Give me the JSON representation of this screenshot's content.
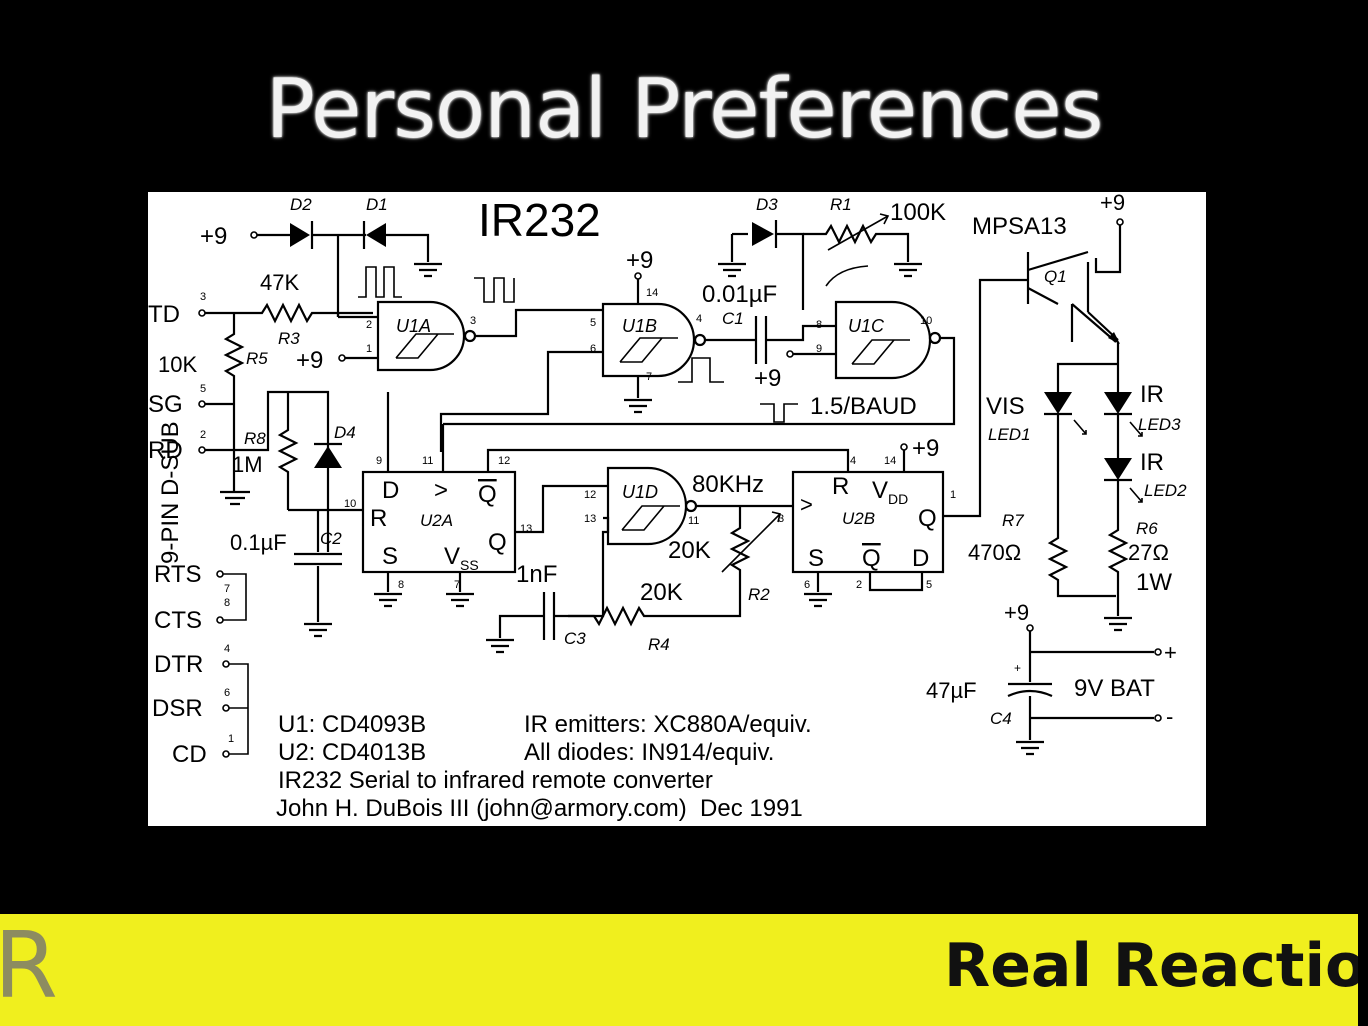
{
  "slide": {
    "title": "Personal Preferences"
  },
  "schematic": {
    "title": "IR232",
    "components": {
      "d2": "D2",
      "d1": "D1",
      "d3": "D3",
      "d4": "D4",
      "r1": "R1",
      "r1_value": "100K",
      "r2": "R2",
      "r2_value": "20K",
      "r3": "R3",
      "r3_value": "47K",
      "r4": "R4",
      "r4_value": "20K",
      "r5": "R5",
      "r5_value": "10K",
      "r6": "R6",
      "r6_value": "27Ω",
      "r6_power": "1W",
      "r7": "R7",
      "r7_value": "470Ω",
      "r8": "R8",
      "r8_value": "1M",
      "c1": "C1",
      "c1_value": "0.01µF",
      "c2": "C2",
      "c2_value": "0.1µF",
      "c3": "C3",
      "c3_value": "1nF",
      "c4": "C4",
      "c4_value": "47µF",
      "q1": "Q1",
      "q1_part": "MPSA13",
      "u1a": "U1A",
      "u1b": "U1B",
      "u1c": "U1C",
      "u1d": "U1D",
      "u2a": "U2A",
      "u2b": "U2B",
      "led1": "LED1",
      "led2": "LED2",
      "led3": "LED3",
      "vis": "VIS",
      "ir_led3": "IR",
      "ir_led2": "IR"
    },
    "supply": {
      "plus9": "+9",
      "battery": "9V BAT",
      "plus": "+",
      "minus": "-"
    },
    "signals": {
      "freq": "80KHz",
      "baud": "1.5/BAUD"
    },
    "connector": {
      "label": "9-PIN D-SUB",
      "pins": [
        {
          "name": "TD",
          "num": "3"
        },
        {
          "name": "SG",
          "num": "5"
        },
        {
          "name": "RD",
          "num": "2"
        },
        {
          "name": "RTS",
          "num": "7"
        },
        {
          "name": "CTS",
          "num": "8"
        },
        {
          "name": "DTR",
          "num": "4"
        },
        {
          "name": "DSR",
          "num": "6"
        },
        {
          "name": "CD",
          "num": "1"
        }
      ]
    },
    "ff_pins": {
      "d": "D",
      "clk": ">",
      "qbar": "Q",
      "r": "R",
      "s": "S",
      "q": "Q",
      "vss": "V",
      "vss_sub": "SS",
      "vdd": "V",
      "vdd_sub": "DD"
    },
    "pin_numbers": {
      "u1a_in1": "2",
      "u1a_in2": "1",
      "u1a_out": "3",
      "u1b_in1": "5",
      "u1b_in2": "6",
      "u1b_out": "4",
      "u1b_vdd": "14",
      "u1b_gnd": "7",
      "u1c_in1": "8",
      "u1c_in2": "9",
      "u1c_out": "10",
      "u1d_in1": "12",
      "u1d_in2": "13",
      "u1d_out": "11",
      "u2a_d": "9",
      "u2a_clk": "11",
      "u2a_qbar": "12",
      "u2a_r": "10",
      "u2a_q": "13",
      "u2a_s": "8",
      "u2a_vss": "7",
      "u2b_r": "4",
      "u2b_vdd": "14",
      "u2b_q": "1",
      "u2b_clk": "3",
      "u2b_s": "6",
      "u2b_qbar": "2",
      "u2b_d": "5"
    },
    "notes": {
      "u1": "U1: CD4093B",
      "u2": "U2: CD4013B",
      "emitters": "IR emitters: XC880A/equiv.",
      "diodes": "All diodes: IN914/equiv.",
      "description": "IR232 Serial to infrared remote converter",
      "author": "John H. DuBois III (john@armory.com)  Dec 1991"
    }
  },
  "footer": {
    "logo": "R",
    "brand": "Real Reactio"
  }
}
